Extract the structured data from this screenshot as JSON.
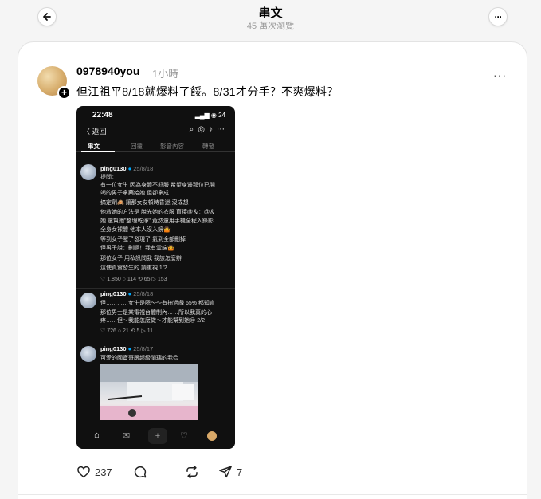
{
  "header": {
    "title": "串文",
    "subtitle": "45 萬次瀏覽"
  },
  "post": {
    "username": "0978940you",
    "time": "1小時",
    "text": "但江祖平8/18就爆料了餒。8/31才分手？不爽爆料？",
    "stats": {
      "likes": "237",
      "reposts_label": "",
      "shares": "7"
    }
  },
  "phone": {
    "time": "22:48",
    "status": "▂▄▆ ◉ 24",
    "back_label": "〈 返回",
    "tabs": [
      "串文",
      "回覆",
      "影音內容",
      "轉發"
    ],
    "posts": [
      {
        "user": "ping0130",
        "date": "25/8/18",
        "lines": [
          "提問：",
          "有一位女生 因為身體不舒服 希望身邊那位已開",
          "竭的男子拿藥給她 但卻拿成",
          "搞定劑🙈 讓那女友頓時昏迷 沒成想",
          "他救她的方法是 脫光她的衣服 直接@＆：@＆",
          "她 還幫她\"整理乾淨\" 竟然還用手機全程入錄影",
          "全身女裸體 他本人沒入鏡🤷",
          "等到女子醒了發現了 氣到全部刪掉",
          "但男子說：刪啊！我有雲端🤷",
          "那位女子 用私訊問我 我該怎麼辦",
          "這使真實發生的 請重視 1/2"
        ],
        "actions": "♡ 1,850   ○ 114   ⟲ 65   ▷ 153"
      },
      {
        "user": "ping0130",
        "date": "25/8/18",
        "lines": [
          "但…………女生是嗯～～有拍過戲 65% 都知道",
          "那位男士是某電視台體制內……所以我真的心",
          "疼……但～我能怎麼做～才能幫到她😢 2/2"
        ],
        "actions": "♡ 726   ○ 21   ⟲ 5   ▷ 11"
      },
      {
        "user": "ping0130",
        "date": "25/8/17",
        "lines": [
          "可愛的國寶哥跟超級閨璃的我😊"
        ],
        "actions": ""
      }
    ]
  },
  "colors": {
    "background": "#f5f5f5",
    "card": "#ffffff",
    "phone": "#101010",
    "muted": "#999999"
  }
}
